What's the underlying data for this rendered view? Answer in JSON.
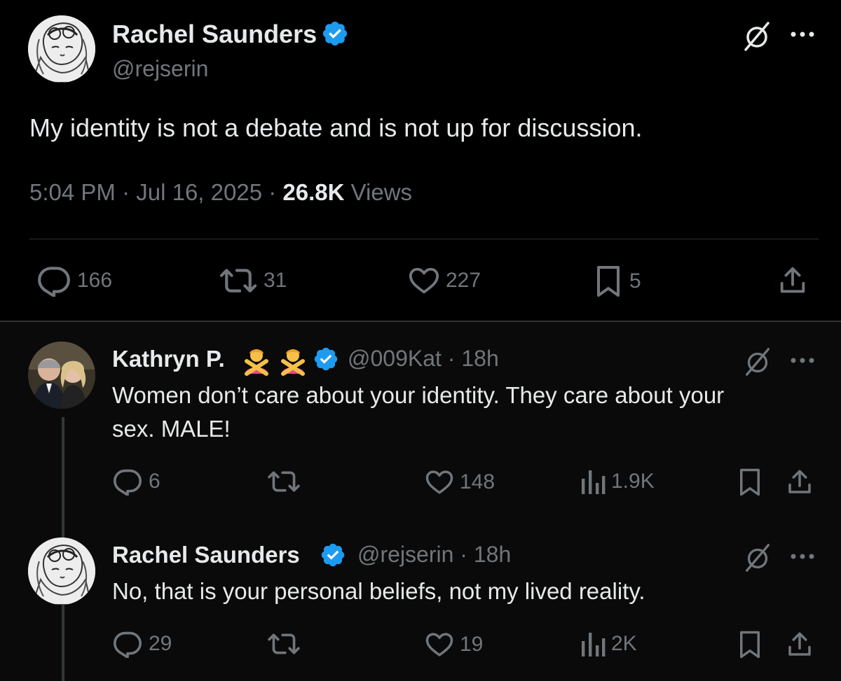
{
  "main_post": {
    "author_name": "Rachel Saunders",
    "handle": "@rejserin",
    "text": "My identity is not a debate and is not up for discussion.",
    "time": "5:04 PM",
    "sep1": " · ",
    "date": "Jul 16, 2025",
    "sep2": " · ",
    "views_count": "26.8K",
    "views_label": " Views",
    "stats": {
      "replies": "166",
      "reposts": "31",
      "likes": "227",
      "bookmarks": "5"
    }
  },
  "replies": [
    {
      "author_name": "Kathryn P.",
      "handle_time": "@009Kat · 18h",
      "text_line1": "Women don’t care about your identity. They care about your",
      "text_line2": "sex. MALE!",
      "stats": {
        "replies": "6",
        "likes": "148",
        "views": "1.9K"
      }
    },
    {
      "author_name": "Rachel Saunders",
      "handle_time": "@rejserin · 18h",
      "text": "No, that is your personal beliefs, not my lived reality.",
      "stats": {
        "replies": "29",
        "likes": "19",
        "views": "2K"
      }
    }
  ],
  "colors": {
    "background": "#000000",
    "reply_background": "#0a0a0a",
    "text": "#e7e9ea",
    "muted": "#71767b",
    "verified": "#1d9bf0"
  }
}
